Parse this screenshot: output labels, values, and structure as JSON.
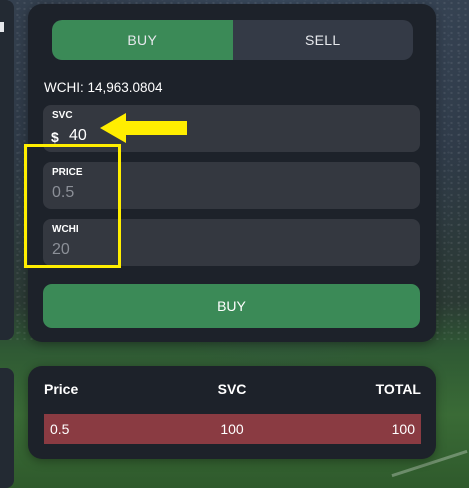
{
  "trade": {
    "tabs": {
      "buy": "BUY",
      "sell": "SELL"
    },
    "active_tab": "buy",
    "balance": "WCHI: 14,963.0804",
    "fields": {
      "svc": {
        "label": "SVC",
        "value": "40",
        "icon": "coin-s-icon",
        "icon_glyph": "$"
      },
      "price": {
        "label": "PRICE",
        "placeholder": "0.5"
      },
      "wchi": {
        "label": "WCHI",
        "placeholder": "20"
      }
    },
    "submit_label": "BUY"
  },
  "order_book": {
    "columns": {
      "price": "Price",
      "svc": "SVC",
      "total": "TOTAL"
    },
    "rows": [
      {
        "price": "0.5",
        "svc": "100",
        "total": "100"
      }
    ]
  },
  "colors": {
    "accent_green": "#3b8a57",
    "sell_row_red": "#8a3b42",
    "annotation_yellow": "#ffee00",
    "panel": "#1d222a"
  }
}
